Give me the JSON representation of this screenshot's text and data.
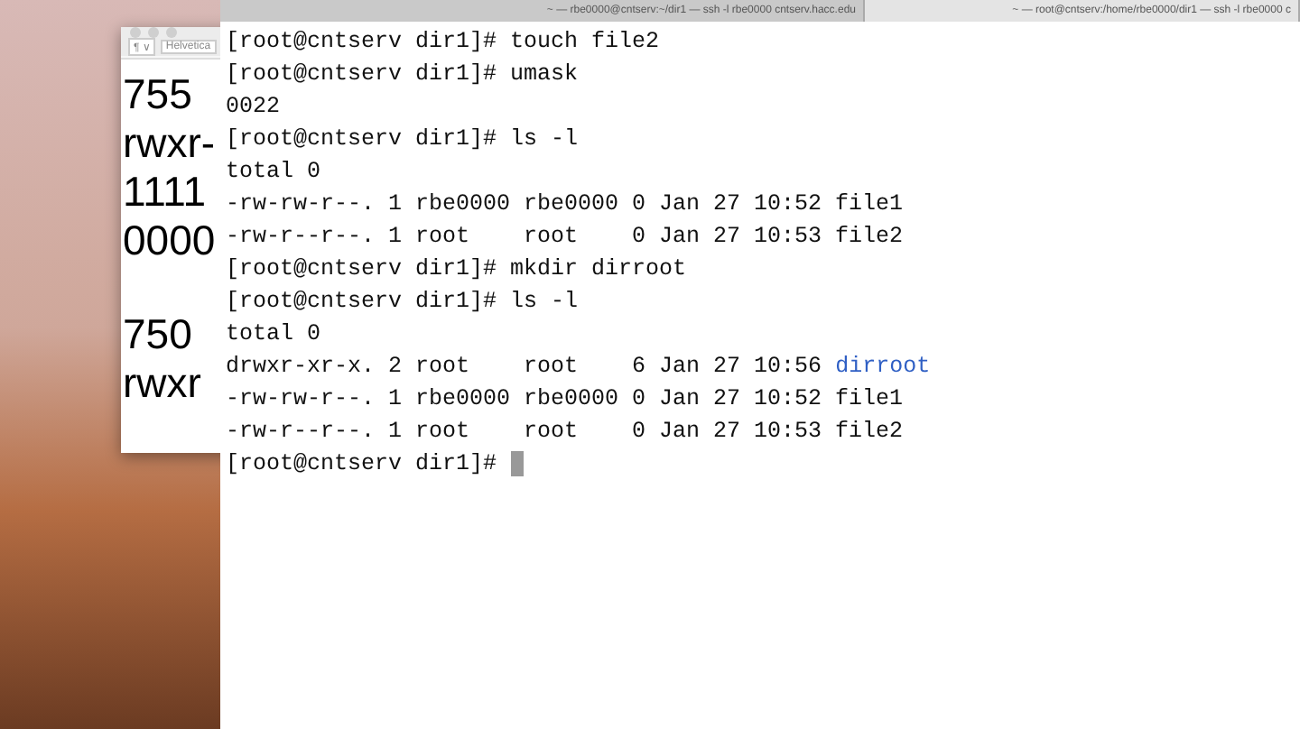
{
  "editor": {
    "toolbar": {
      "paragraph_menu": "¶ ∨",
      "font_menu": "Helvetica"
    },
    "paragraphs": [
      [
        "755",
        "rwxr-",
        "1111",
        "0000"
      ],
      [
        "750",
        "rwxr"
      ]
    ]
  },
  "terminal": {
    "tabs": [
      {
        "title": "~ — rbe0000@cntserv:~/dir1 — ssh -l rbe0000 cntserv.hacc.edu",
        "selected": false
      },
      {
        "title": "~ — root@cntserv:/home/rbe0000/dir1 — ssh -l rbe0000 c",
        "selected": true
      }
    ],
    "lines": [
      [
        {
          "text": "[root@cntserv dir1]# touch file2",
          "kind": "plain"
        }
      ],
      [
        {
          "text": "[root@cntserv dir1]# umask",
          "kind": "plain"
        }
      ],
      [
        {
          "text": "0022",
          "kind": "plain"
        }
      ],
      [
        {
          "text": "[root@cntserv dir1]# ls -l",
          "kind": "plain"
        }
      ],
      [
        {
          "text": "total 0",
          "kind": "plain"
        }
      ],
      [
        {
          "text": "-rw-rw-r--. 1 rbe0000 rbe0000 0 Jan 27 10:52 file1",
          "kind": "plain"
        }
      ],
      [
        {
          "text": "-rw-r--r--. 1 root    root    0 Jan 27 10:53 file2",
          "kind": "plain"
        }
      ],
      [
        {
          "text": "[root@cntserv dir1]# mkdir dirroot",
          "kind": "plain"
        }
      ],
      [
        {
          "text": "[root@cntserv dir1]# ls -l",
          "kind": "plain"
        }
      ],
      [
        {
          "text": "total 0",
          "kind": "plain"
        }
      ],
      [
        {
          "text": "drwxr-xr-x. 2 root    root    6 Jan 27 10:56 ",
          "kind": "plain"
        },
        {
          "text": "dirroot",
          "kind": "directory"
        }
      ],
      [
        {
          "text": "-rw-rw-r--. 1 rbe0000 rbe0000 0 Jan 27 10:52 file1",
          "kind": "plain"
        }
      ],
      [
        {
          "text": "-rw-r--r--. 1 root    root    0 Jan 27 10:53 file2",
          "kind": "plain"
        }
      ],
      [
        {
          "text": "[root@cntserv dir1]# ",
          "kind": "plain"
        }
      ]
    ],
    "cursor": true
  }
}
